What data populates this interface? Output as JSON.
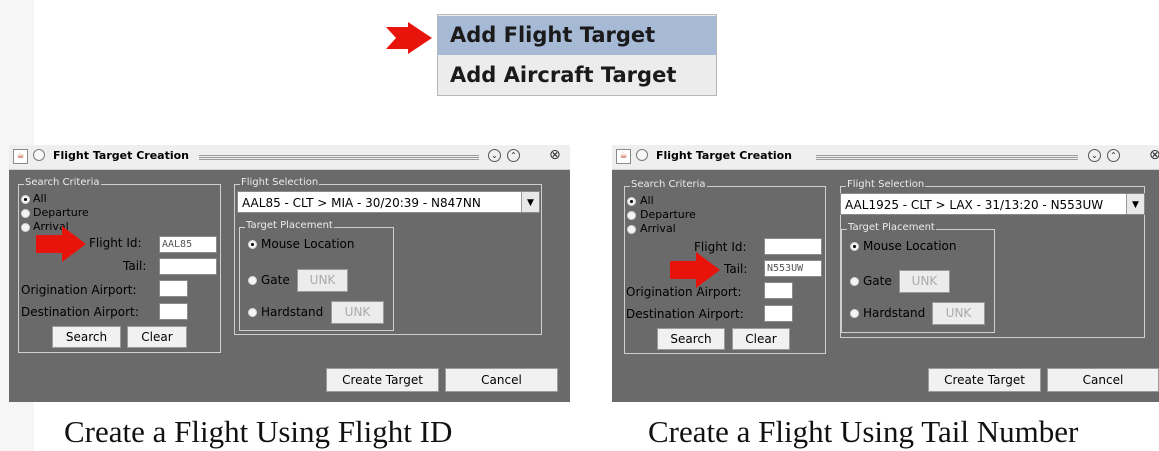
{
  "context_menu": {
    "items": [
      "Add Flight Target",
      "Add Aircraft Target"
    ]
  },
  "dialogs": [
    {
      "title": "Flight Target Creation",
      "search_criteria": {
        "legend": "Search Criteria",
        "radio_all": "All",
        "radio_departure": "Departure",
        "radio_arrival": "Arrival",
        "flight_id_label": "Flight Id:",
        "flight_id_value": "AAL85",
        "tail_label": "Tail:",
        "tail_value": "",
        "origination_label": "Origination Airport:",
        "destination_label": "Destination Airport:",
        "search_button": "Search",
        "clear_button": "Clear"
      },
      "flight_selection": {
        "legend": "Flight Selection",
        "selected": "AAL85 - CLT > MIA - 30/20:39 - N847NN"
      },
      "target_placement": {
        "legend": "Target Placement",
        "mouse_location": "Mouse Location",
        "gate": "Gate",
        "gate_value": "UNK",
        "hardstand": "Hardstand",
        "hardstand_value": "UNK"
      },
      "create_button": "Create Target",
      "cancel_button": "Cancel"
    },
    {
      "title": "Flight Target Creation",
      "search_criteria": {
        "legend": "Search Criteria",
        "radio_all": "All",
        "radio_departure": "Departure",
        "radio_arrival": "Arrival",
        "flight_id_label": "Flight Id:",
        "flight_id_value": "",
        "tail_label": "Tail:",
        "tail_value": "N553UW",
        "origination_label": "Origination Airport:",
        "destination_label": "Destination Airport:",
        "search_button": "Search",
        "clear_button": "Clear"
      },
      "flight_selection": {
        "legend": "Flight Selection",
        "selected": "AAL1925 - CLT > LAX - 31/13:20 - N553UW"
      },
      "target_placement": {
        "legend": "Target Placement",
        "mouse_location": "Mouse Location",
        "gate": "Gate",
        "gate_value": "UNK",
        "hardstand": "Hardstand",
        "hardstand_value": "UNK"
      },
      "create_button": "Create Target",
      "cancel_button": "Cancel"
    }
  ],
  "captions": [
    "Create a Flight Using Flight ID",
    "Create a Flight Using Tail Number"
  ],
  "colors": {
    "arrow": "#e8140c",
    "dialog_bg": "#6a6a6a",
    "menu_highlight": "#a6bad6"
  },
  "icons": [
    "red-arrow-icon",
    "java-app-icon",
    "minimize-icon",
    "maximize-icon",
    "close-icon",
    "dropdown-arrow-icon"
  ]
}
